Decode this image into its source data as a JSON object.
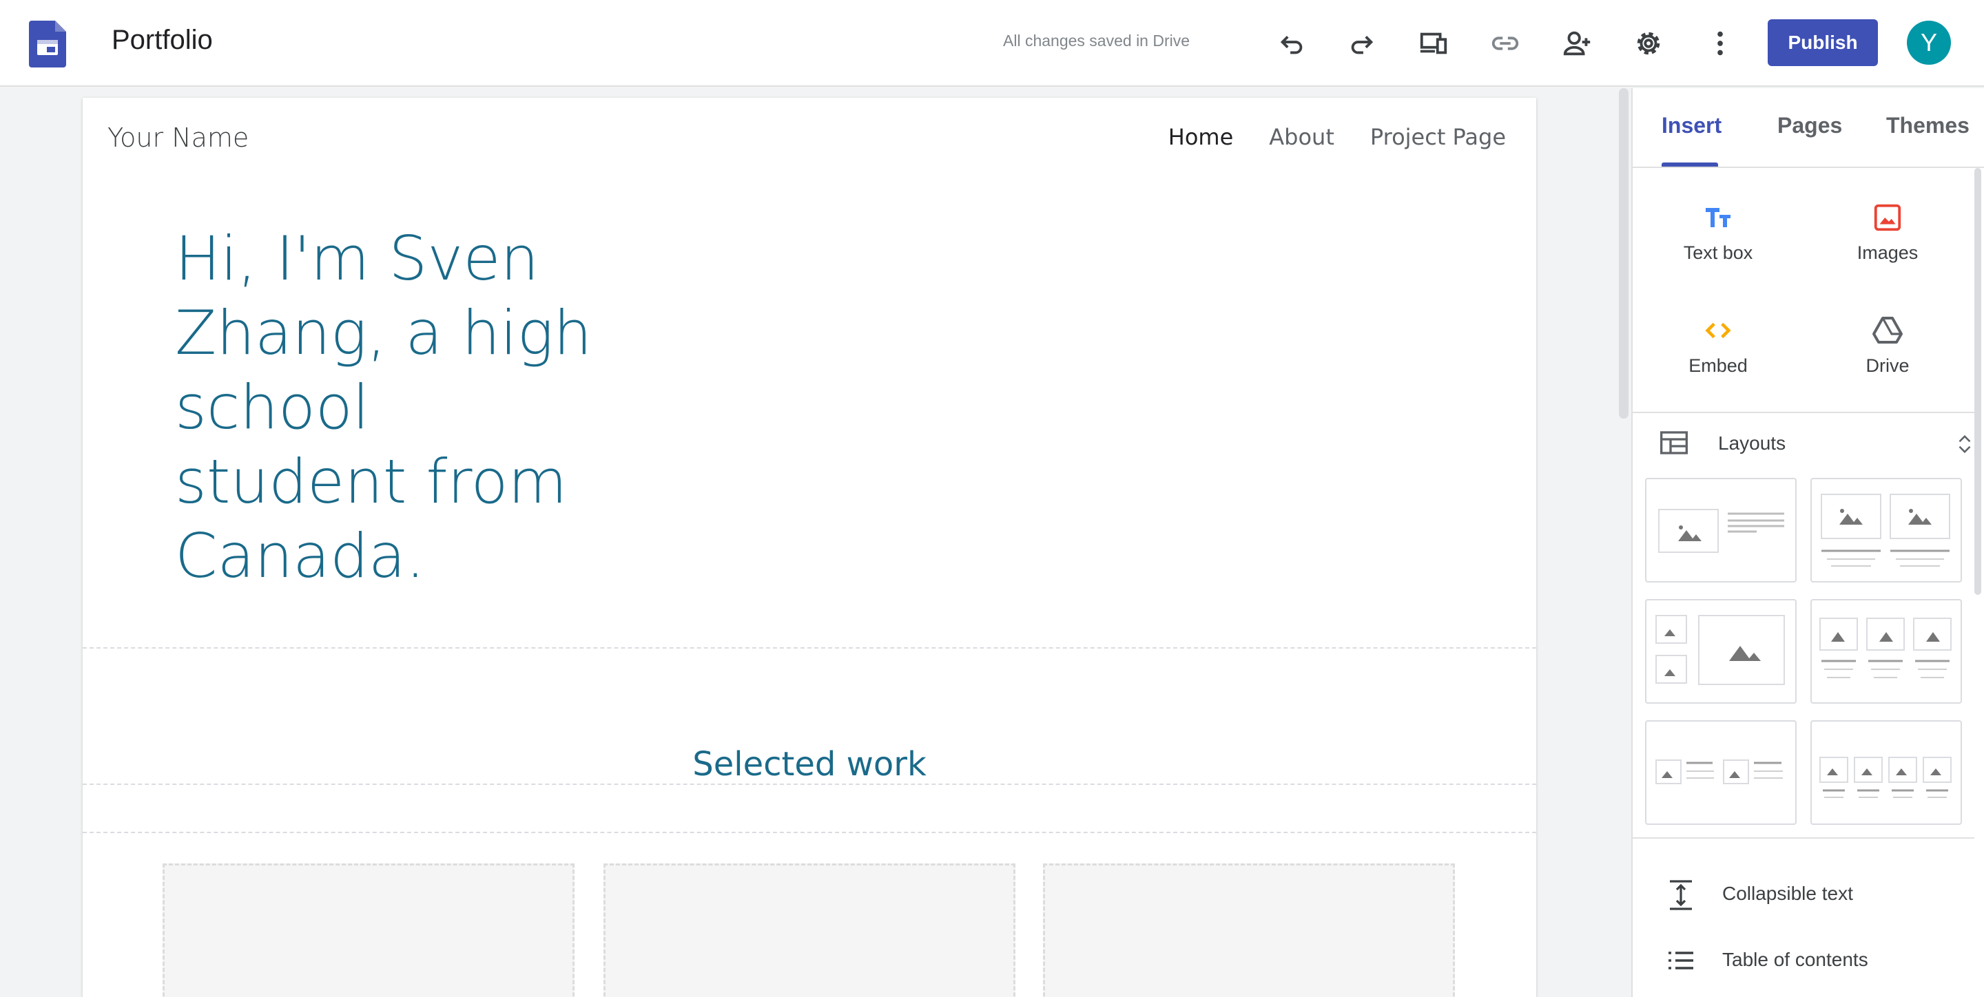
{
  "app": {
    "title": "Portfolio",
    "save_status": "All changes saved in Drive",
    "publish_label": "Publish",
    "avatar_initial": "Y",
    "accent_color": "#3f51b5",
    "toolbar_icons": [
      "undo-icon",
      "redo-icon",
      "preview-icon",
      "link-icon",
      "share-icon",
      "settings-icon",
      "more-icon"
    ]
  },
  "site": {
    "name": "Your Name",
    "nav": [
      {
        "label": "Home",
        "active": true
      },
      {
        "label": "About",
        "active": false
      },
      {
        "label": "Project Page",
        "active": false
      }
    ],
    "hero_text": "Hi, I'm Sven Zhang, a high school student from Canada.",
    "section_title": "Selected work",
    "heading_color": "#1a6a8a"
  },
  "panel": {
    "tabs": [
      {
        "label": "Insert",
        "active": true
      },
      {
        "label": "Pages",
        "active": false
      },
      {
        "label": "Themes",
        "active": false
      }
    ],
    "insert_items": [
      {
        "label": "Text box",
        "icon": "text-box-icon"
      },
      {
        "label": "Images",
        "icon": "image-icon"
      },
      {
        "label": "Embed",
        "icon": "embed-icon"
      },
      {
        "label": "Drive",
        "icon": "drive-icon"
      }
    ],
    "layouts_label": "Layouts",
    "list_items": [
      {
        "label": "Collapsible text",
        "icon": "collapsible-text-icon"
      },
      {
        "label": "Table of contents",
        "icon": "table-of-contents-icon"
      }
    ]
  }
}
